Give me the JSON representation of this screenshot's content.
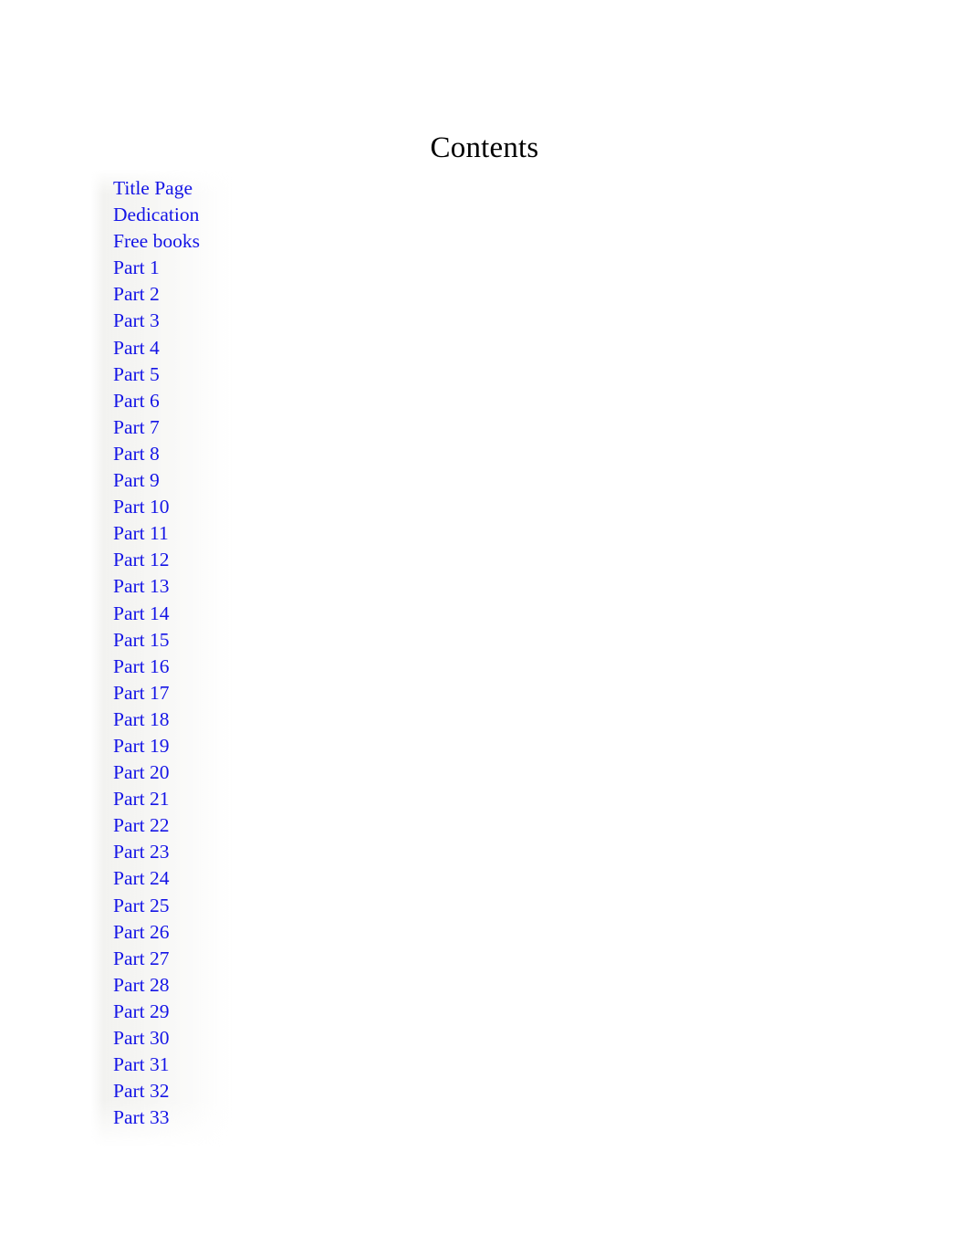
{
  "document": {
    "title": "Contents",
    "page_background": "#ffffff",
    "link_color": "#1414e6",
    "title_color": "#000000"
  },
  "toc": {
    "heading": "Contents",
    "items": [
      {
        "label": "Title Page"
      },
      {
        "label": "Dedication"
      },
      {
        "label": "Free books"
      },
      {
        "label": "Part 1"
      },
      {
        "label": "Part 2"
      },
      {
        "label": "Part 3"
      },
      {
        "label": "Part 4"
      },
      {
        "label": "Part 5"
      },
      {
        "label": "Part 6"
      },
      {
        "label": "Part 7"
      },
      {
        "label": "Part 8"
      },
      {
        "label": "Part 9"
      },
      {
        "label": "Part 10"
      },
      {
        "label": "Part 11"
      },
      {
        "label": "Part 12"
      },
      {
        "label": "Part 13"
      },
      {
        "label": "Part 14"
      },
      {
        "label": "Part 15"
      },
      {
        "label": "Part 16"
      },
      {
        "label": "Part 17"
      },
      {
        "label": "Part 18"
      },
      {
        "label": "Part 19"
      },
      {
        "label": "Part 20"
      },
      {
        "label": "Part 21"
      },
      {
        "label": "Part 22"
      },
      {
        "label": "Part 23"
      },
      {
        "label": "Part 24"
      },
      {
        "label": "Part 25"
      },
      {
        "label": "Part 26"
      },
      {
        "label": "Part 27"
      },
      {
        "label": "Part 28"
      },
      {
        "label": "Part 29"
      },
      {
        "label": "Part 30"
      },
      {
        "label": "Part 31"
      },
      {
        "label": "Part 32"
      },
      {
        "label": "Part 33"
      }
    ]
  }
}
